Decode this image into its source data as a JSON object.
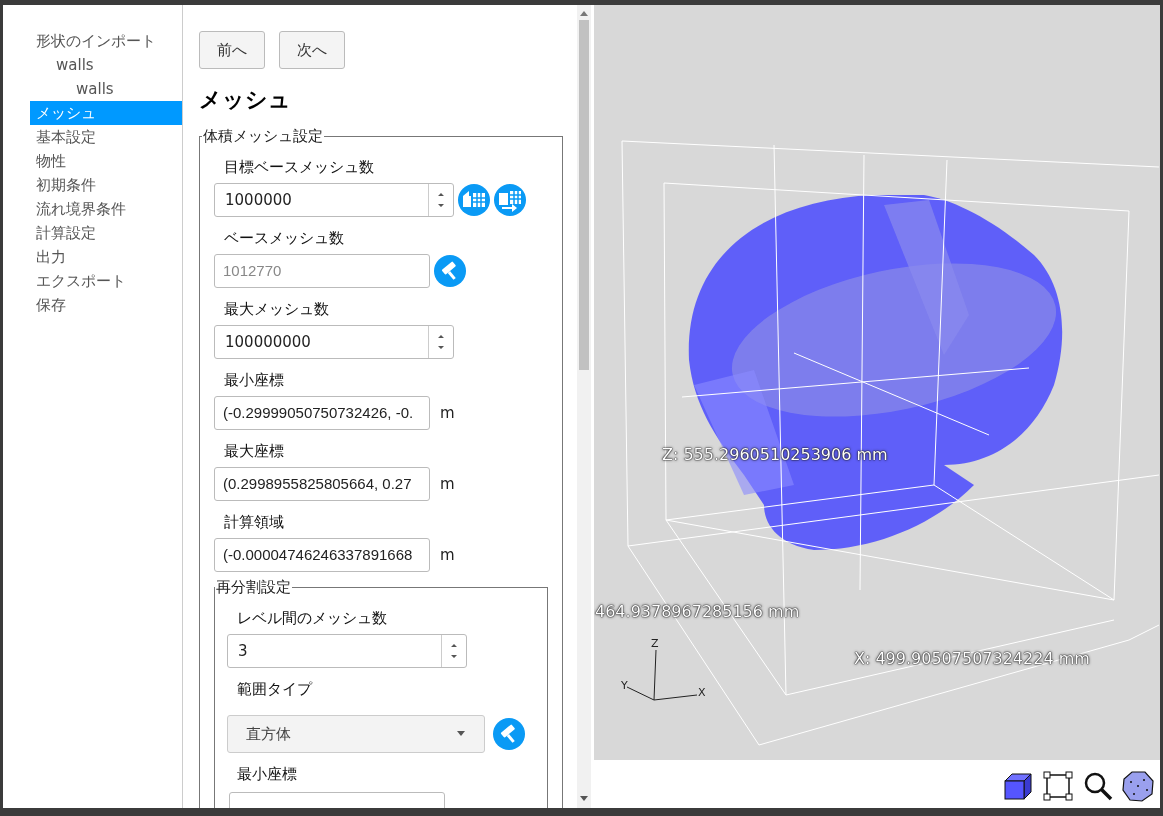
{
  "nav": [
    {
      "label": "形状のインポート",
      "selected": false,
      "children": [
        {
          "label": "walls",
          "selected": false,
          "children": [
            {
              "label": "walls",
              "selected": false
            }
          ]
        }
      ]
    },
    {
      "label": "メッシュ",
      "selected": true
    },
    {
      "label": "基本設定",
      "selected": false
    },
    {
      "label": "物性",
      "selected": false
    },
    {
      "label": "初期条件",
      "selected": false
    },
    {
      "label": "流れ境界条件",
      "selected": false
    },
    {
      "label": "計算設定",
      "selected": false
    },
    {
      "label": "出力",
      "selected": false
    },
    {
      "label": "エクスポート",
      "selected": false
    },
    {
      "label": "保存",
      "selected": false
    }
  ],
  "buttons": [
    "前へ",
    "次へ"
  ],
  "heading": "メッシュ",
  "volume_mesh": {
    "legend": "体積メッシュ設定",
    "fields": [
      {
        "kind": "spin-tools",
        "label": "目標ベースメッシュ数",
        "value": "1000000"
      },
      {
        "kind": "readonly",
        "label": "ベースメッシュ数",
        "value": "1012770",
        "disabled": true
      },
      {
        "kind": "spin",
        "label": "最大メッシュ数",
        "value": "100000000"
      },
      {
        "kind": "unit",
        "label": "最小座標",
        "value": "(-0.29999050750732426, -0.",
        "unit": "m"
      },
      {
        "kind": "unit",
        "label": "最大座標",
        "value": "(0.2998955825805664, 0.27",
        "unit": "m"
      },
      {
        "kind": "unit",
        "label": "計算領域",
        "value": "(-0.00004746246337891668",
        "unit": "m"
      }
    ]
  },
  "refinement": {
    "legend": "再分割設定",
    "fields": [
      {
        "kind": "spin",
        "label": "レベル間のメッシュ数",
        "value": "3"
      },
      {
        "kind": "select",
        "label": "範囲タイプ",
        "value": "直方体"
      },
      {
        "kind": "cut",
        "label": "最小座標"
      }
    ]
  },
  "viewer": {
    "labels": [
      {
        "kind": "z",
        "text": "Z: 555.2960510253906 mm"
      },
      {
        "kind": "y",
        "text": "464.9378967285156 mm"
      },
      {
        "kind": "x",
        "text": "X: 499.90507507324224 mm"
      }
    ],
    "axes": [
      "Z",
      "Y",
      "X"
    ]
  }
}
